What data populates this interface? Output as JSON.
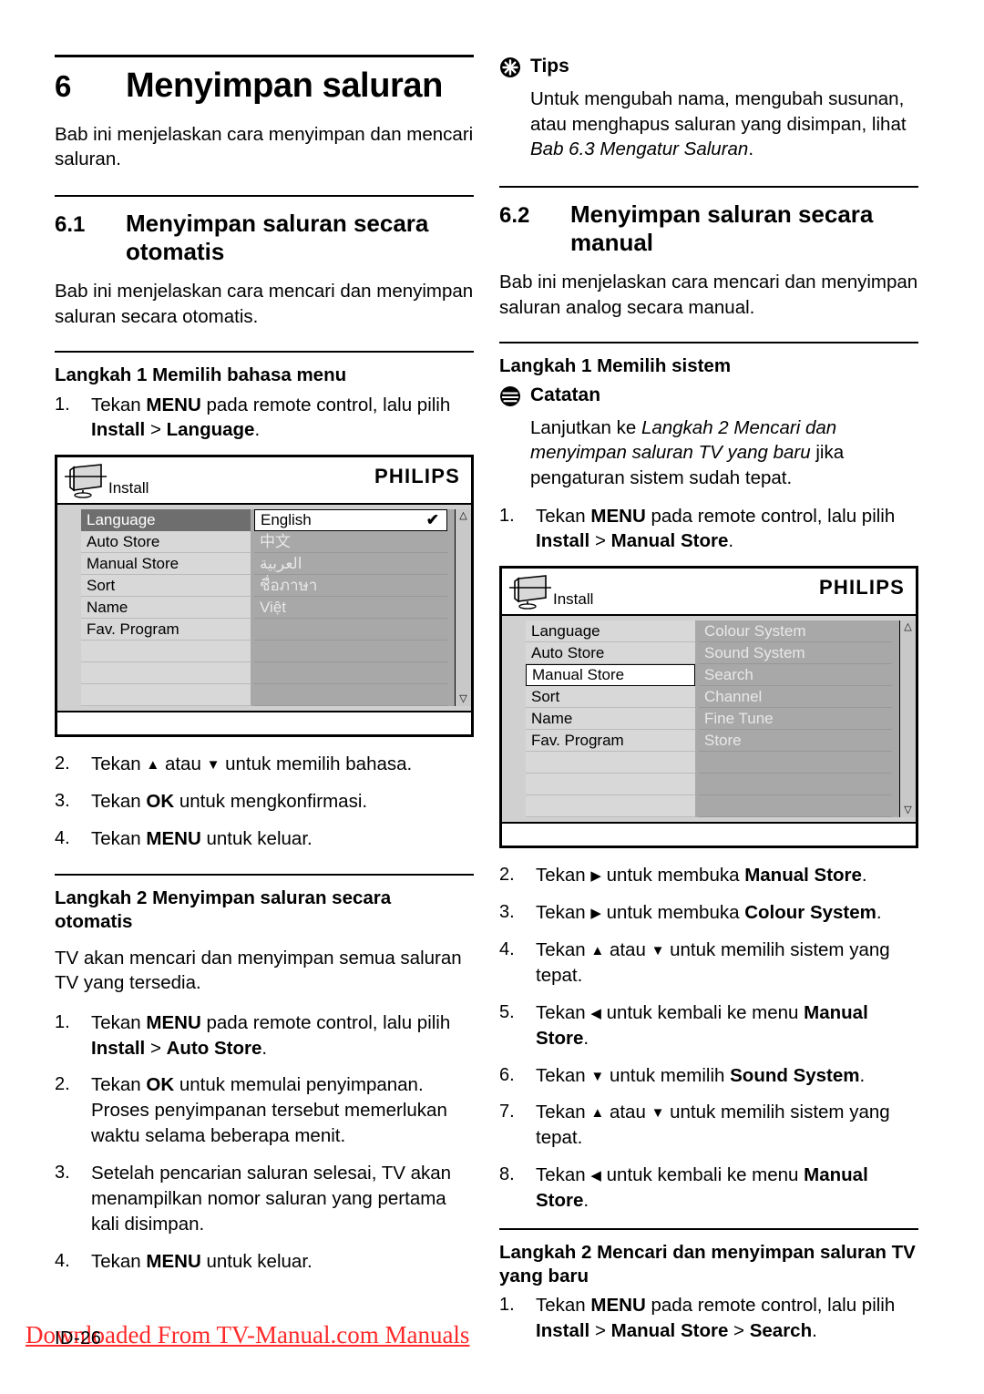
{
  "document": {
    "page_number": "ID-26",
    "watermark": "Downloaded From TV-Manual.com Manuals",
    "watermark_color": "#ff2a2a"
  },
  "left_column": {
    "chapter": {
      "number": "6",
      "title": "Menyimpan saluran"
    },
    "intro": "Bab ini menjelaskan cara menyimpan dan mencari saluran.",
    "section_6_1": {
      "number": "6.1",
      "title": "Menyimpan saluran secara otomatis",
      "intro": "Bab ini menjelaskan cara mencari dan menyimpan saluran secara otomatis.",
      "step1_heading": "Langkah 1 Memilih bahasa menu",
      "step1_items": [
        {
          "n": "1.",
          "parts": [
            {
              "t": "Tekan ",
              "s": "plain"
            },
            {
              "t": "MENU",
              "s": "bold"
            },
            {
              "t": " pada remote control, lalu pilih ",
              "s": "plain"
            },
            {
              "t": "Install",
              "s": "bold"
            },
            {
              "t": " > ",
              "s": "plain"
            },
            {
              "t": "Language",
              "s": "bold"
            },
            {
              "t": ".",
              "s": "plain"
            }
          ]
        }
      ],
      "step1_items_after": [
        {
          "n": "2.",
          "parts": [
            {
              "t": "Tekan ",
              "s": "plain"
            },
            {
              "t": "▲",
              "s": "arrow"
            },
            {
              "t": " atau ",
              "s": "plain"
            },
            {
              "t": "▼",
              "s": "arrow"
            },
            {
              "t": " untuk memilih bahasa.",
              "s": "plain"
            }
          ]
        },
        {
          "n": "3.",
          "parts": [
            {
              "t": "Tekan ",
              "s": "plain"
            },
            {
              "t": "OK",
              "s": "bold"
            },
            {
              "t": " untuk mengkonfirmasi.",
              "s": "plain"
            }
          ]
        },
        {
          "n": "4.",
          "parts": [
            {
              "t": "Tekan ",
              "s": "plain"
            },
            {
              "t": "MENU",
              "s": "bold"
            },
            {
              "t": " untuk keluar.",
              "s": "plain"
            }
          ]
        }
      ],
      "step2_heading": "Langkah 2 Menyimpan saluran secara otomatis",
      "step2_intro": "TV akan mencari dan menyimpan semua saluran TV yang tersedia.",
      "step2_items": [
        {
          "n": "1.",
          "parts": [
            {
              "t": "Tekan ",
              "s": "plain"
            },
            {
              "t": "MENU",
              "s": "bold"
            },
            {
              "t": " pada remote control, lalu pilih ",
              "s": "plain"
            },
            {
              "t": "Install",
              "s": "bold"
            },
            {
              "t": " > ",
              "s": "plain"
            },
            {
              "t": "Auto Store",
              "s": "bold"
            },
            {
              "t": ".",
              "s": "plain"
            }
          ]
        },
        {
          "n": "2.",
          "parts": [
            {
              "t": "Tekan ",
              "s": "plain"
            },
            {
              "t": "OK",
              "s": "bold"
            },
            {
              "t": " untuk memulai penyimpanan. Proses penyimpanan tersebut memerlukan waktu selama beberapa menit.",
              "s": "plain"
            }
          ]
        },
        {
          "n": "3.",
          "parts": [
            {
              "t": "Setelah pencarian saluran selesai, TV akan menampilkan nomor saluran yang pertama kali disimpan.",
              "s": "plain"
            }
          ]
        },
        {
          "n": "4.",
          "parts": [
            {
              "t": "Tekan ",
              "s": "plain"
            },
            {
              "t": "MENU",
              "s": "bold"
            },
            {
              "t": " untuk keluar.",
              "s": "plain"
            }
          ]
        }
      ]
    }
  },
  "right_column": {
    "tips": {
      "icon": "tips-asterisk-icon",
      "title": "Tips",
      "body_parts": [
        {
          "t": "Untuk mengubah nama, mengubah susunan, atau menghapus saluran yang disimpan, lihat ",
          "s": "plain"
        },
        {
          "t": "Bab 6.3 Mengatur Saluran",
          "s": "italic"
        },
        {
          "t": ".",
          "s": "plain"
        }
      ]
    },
    "section_6_2": {
      "number": "6.2",
      "title": "Menyimpan saluran secara manual",
      "intro": "Bab ini menjelaskan cara mencari dan menyimpan saluran analog secara manual.",
      "step1_heading": "Langkah 1 Memilih sistem",
      "note": {
        "icon": "note-lines-icon",
        "title": "Catatan",
        "body_parts": [
          {
            "t": "Lanjutkan ke ",
            "s": "plain"
          },
          {
            "t": "Langkah 2 Mencari dan menyimpan saluran TV yang baru",
            "s": "italic"
          },
          {
            "t": " jika pengaturan sistem sudah tepat.",
            "s": "plain"
          }
        ]
      },
      "step1_items": [
        {
          "n": "1.",
          "parts": [
            {
              "t": "Tekan ",
              "s": "plain"
            },
            {
              "t": "MENU",
              "s": "bold"
            },
            {
              "t": " pada remote control, lalu pilih ",
              "s": "plain"
            },
            {
              "t": "Install",
              "s": "bold"
            },
            {
              "t": " > ",
              "s": "plain"
            },
            {
              "t": "Manual Store",
              "s": "bold"
            },
            {
              "t": ".",
              "s": "plain"
            }
          ]
        }
      ],
      "step1_items_after": [
        {
          "n": "2.",
          "parts": [
            {
              "t": "Tekan ",
              "s": "plain"
            },
            {
              "t": "▶",
              "s": "arrow"
            },
            {
              "t": " untuk membuka ",
              "s": "plain"
            },
            {
              "t": "Manual Store",
              "s": "bold"
            },
            {
              "t": ".",
              "s": "plain"
            }
          ]
        },
        {
          "n": "3.",
          "parts": [
            {
              "t": "Tekan ",
              "s": "plain"
            },
            {
              "t": "▶",
              "s": "arrow"
            },
            {
              "t": " untuk membuka ",
              "s": "plain"
            },
            {
              "t": "Colour System",
              "s": "bold"
            },
            {
              "t": ".",
              "s": "plain"
            }
          ]
        },
        {
          "n": "4.",
          "parts": [
            {
              "t": "Tekan ",
              "s": "plain"
            },
            {
              "t": "▲",
              "s": "arrow"
            },
            {
              "t": " atau ",
              "s": "plain"
            },
            {
              "t": "▼",
              "s": "arrow"
            },
            {
              "t": " untuk memilih sistem yang tepat.",
              "s": "plain"
            }
          ]
        },
        {
          "n": "5.",
          "parts": [
            {
              "t": "Tekan ",
              "s": "plain"
            },
            {
              "t": "◀",
              "s": "arrow"
            },
            {
              "t": " untuk kembali ke menu ",
              "s": "plain"
            },
            {
              "t": "Manual Store",
              "s": "bold"
            },
            {
              "t": ".",
              "s": "plain"
            }
          ]
        },
        {
          "n": "6.",
          "parts": [
            {
              "t": "Tekan ",
              "s": "plain"
            },
            {
              "t": "▼",
              "s": "arrow"
            },
            {
              "t": " untuk memilih ",
              "s": "plain"
            },
            {
              "t": "Sound System",
              "s": "bold"
            },
            {
              "t": ".",
              "s": "plain"
            }
          ]
        },
        {
          "n": "7.",
          "parts": [
            {
              "t": "Tekan ",
              "s": "plain"
            },
            {
              "t": "▲",
              "s": "arrow"
            },
            {
              "t": " atau ",
              "s": "plain"
            },
            {
              "t": "▼",
              "s": "arrow"
            },
            {
              "t": " untuk memilih sistem yang tepat.",
              "s": "plain"
            }
          ]
        },
        {
          "n": "8.",
          "parts": [
            {
              "t": "Tekan ",
              "s": "plain"
            },
            {
              "t": "◀",
              "s": "arrow"
            },
            {
              "t": " untuk kembali ke menu ",
              "s": "plain"
            },
            {
              "t": "Manual Store",
              "s": "bold"
            },
            {
              "t": ".",
              "s": "plain"
            }
          ]
        }
      ],
      "step2_heading": "Langkah 2 Mencari dan menyimpan saluran TV yang baru",
      "step2_items": [
        {
          "n": "1.",
          "parts": [
            {
              "t": "Tekan ",
              "s": "plain"
            },
            {
              "t": "MENU",
              "s": "bold"
            },
            {
              "t": " pada remote control, lalu pilih ",
              "s": "plain"
            },
            {
              "t": "Install",
              "s": "bold"
            },
            {
              "t": " > ",
              "s": "plain"
            },
            {
              "t": "Manual Store",
              "s": "bold"
            },
            {
              "t": " > ",
              "s": "plain"
            },
            {
              "t": "Search",
              "s": "bold"
            },
            {
              "t": ".",
              "s": "plain"
            }
          ]
        }
      ]
    }
  },
  "tv_menu_language": {
    "brand": "PHILIPS",
    "breadcrumb": "Install",
    "left_items": [
      {
        "label": "Language",
        "state": "selected-dark"
      },
      {
        "label": "Auto Store",
        "state": "normal"
      },
      {
        "label": "Manual Store",
        "state": "normal"
      },
      {
        "label": "Sort",
        "state": "normal"
      },
      {
        "label": "Name",
        "state": "normal"
      },
      {
        "label": "Fav. Program",
        "state": "normal"
      },
      {
        "label": "",
        "state": "blank"
      },
      {
        "label": "",
        "state": "blank"
      },
      {
        "label": "",
        "state": "blank"
      }
    ],
    "right_items": [
      {
        "label": "English",
        "state": "selected-white",
        "check": "✔"
      },
      {
        "label": "中文",
        "state": "normal"
      },
      {
        "label": "العربية",
        "state": "normal"
      },
      {
        "label": "ชื่อภาษา",
        "state": "normal"
      },
      {
        "label": "Việt",
        "state": "normal"
      },
      {
        "label": "",
        "state": "blank"
      },
      {
        "label": "",
        "state": "blank"
      },
      {
        "label": "",
        "state": "blank"
      },
      {
        "label": "",
        "state": "blank"
      }
    ],
    "scroll_up": "△",
    "scroll_down": "▽"
  },
  "tv_menu_manual_store": {
    "brand": "PHILIPS",
    "breadcrumb": "Install",
    "left_items": [
      {
        "label": "Language",
        "state": "normal"
      },
      {
        "label": "Auto Store",
        "state": "normal"
      },
      {
        "label": "Manual Store",
        "state": "selected-white"
      },
      {
        "label": "Sort",
        "state": "normal"
      },
      {
        "label": "Name",
        "state": "normal"
      },
      {
        "label": "Fav. Program",
        "state": "normal"
      },
      {
        "label": "",
        "state": "blank"
      },
      {
        "label": "",
        "state": "blank"
      },
      {
        "label": "",
        "state": "blank"
      }
    ],
    "right_items": [
      {
        "label": "Colour System",
        "state": "normal"
      },
      {
        "label": "Sound System",
        "state": "normal"
      },
      {
        "label": "Search",
        "state": "normal"
      },
      {
        "label": "Channel",
        "state": "normal"
      },
      {
        "label": "Fine Tune",
        "state": "normal"
      },
      {
        "label": "Store",
        "state": "normal"
      },
      {
        "label": "",
        "state": "blank"
      },
      {
        "label": "",
        "state": "blank"
      },
      {
        "label": "",
        "state": "blank"
      }
    ],
    "scroll_up": "△",
    "scroll_down": "▽"
  }
}
